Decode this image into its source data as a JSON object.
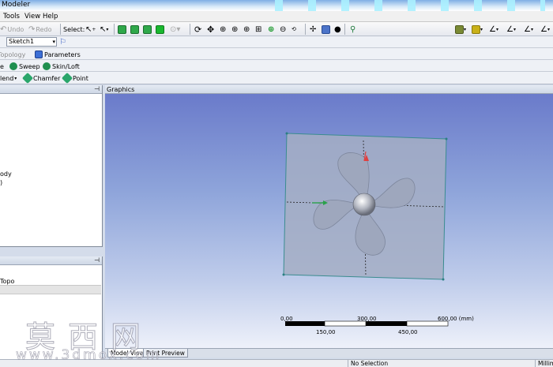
{
  "window": {
    "title": "Modeler"
  },
  "menu": {
    "items": [
      "Tools",
      "View",
      "Help"
    ]
  },
  "toolbar": {
    "undo_label": "Undo",
    "redo_label": "Redo",
    "select_label": "Select:"
  },
  "sketch_selector": {
    "value": "Sketch1"
  },
  "tabs_row": {
    "topology": "Topology",
    "parameters": "Parameters"
  },
  "features_row": {
    "sweep": "Sweep",
    "skin_loft": "Skin/Loft"
  },
  "features_row2": {
    "blend": "lend",
    "chamfer": "Chamfer",
    "point": "Point"
  },
  "tree": {
    "items": [
      "ody",
      ")"
    ]
  },
  "details": {
    "rows": [
      "Topo",
      ""
    ]
  },
  "graphics": {
    "header": "Graphics",
    "scale_labels_top": [
      "0,00",
      "300,00",
      "600,00 (mm)"
    ],
    "scale_labels_bottom": [
      "150,00",
      "450,00"
    ]
  },
  "view_tabs": {
    "model_view": "Model View",
    "print_preview": "Print Preview"
  },
  "status": {
    "selection": "No Selection",
    "units": "Millim"
  },
  "watermark": {
    "chinese": "莫西网",
    "url": "www.3dmox.com"
  },
  "colors": {
    "accent": "#3a5fc4",
    "plane": "#a9b2c6",
    "background_top": "#6777c9"
  }
}
